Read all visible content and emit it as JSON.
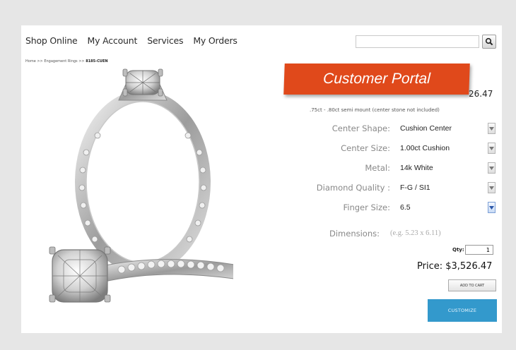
{
  "nav": {
    "items": [
      "Shop Online",
      "My Account",
      "Services",
      "My Orders"
    ]
  },
  "search": {
    "value": "",
    "button_icon": "search-icon"
  },
  "breadcrumb": {
    "home": "Home",
    "section": "Engagement Rings",
    "current": "8185-CUEN",
    "separator": ">>"
  },
  "banner": {
    "text": "Customer Portal",
    "color": "#e0491b"
  },
  "product": {
    "price_partial": "26.47",
    "description": ".75ct - .80ct semi mount (center stone not included)"
  },
  "options": [
    {
      "label": "Center Shape:",
      "value": "Cushion Center"
    },
    {
      "label": "Center Size:",
      "value": "1.00ct Cushion"
    },
    {
      "label": "Metal:",
      "value": "14k White"
    },
    {
      "label": "Diamond Quality :",
      "value": "F-G / SI1"
    },
    {
      "label": "Finger Size:",
      "value": "6.5"
    }
  ],
  "dimensions": {
    "label": "Dimensions:",
    "hint": "(e.g. 5.23 x 6.11)"
  },
  "qty": {
    "label": "Qty:",
    "value": "1"
  },
  "price": {
    "text": "Price: $3,526.47"
  },
  "buttons": {
    "add_to_cart": "ADD TO CART",
    "customize": "CUSTOMIZE"
  },
  "colors": {
    "accent": "#3399cc",
    "banner": "#e0491b",
    "background": "#e6e6e6"
  }
}
